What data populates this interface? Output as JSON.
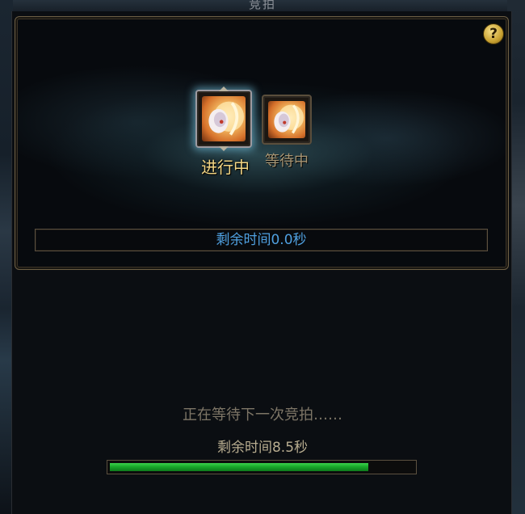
{
  "window": {
    "title": "竞拍"
  },
  "help": {
    "label": "?"
  },
  "auction": {
    "slots": [
      {
        "status": "进行中",
        "state": "active"
      },
      {
        "status": "等待中",
        "state": "waiting"
      }
    ],
    "remaining_label": "剩余时间0.0秒"
  },
  "next": {
    "waiting_label": "正在等待下一次竞拍……",
    "remaining_label": "剩余时间8.5秒",
    "progress": 0.85
  },
  "colors": {
    "accent_gold": "#f3d684",
    "timer_blue": "#4fa0e0",
    "progress_green": "#18a82a",
    "frame": "#6d5f45"
  }
}
